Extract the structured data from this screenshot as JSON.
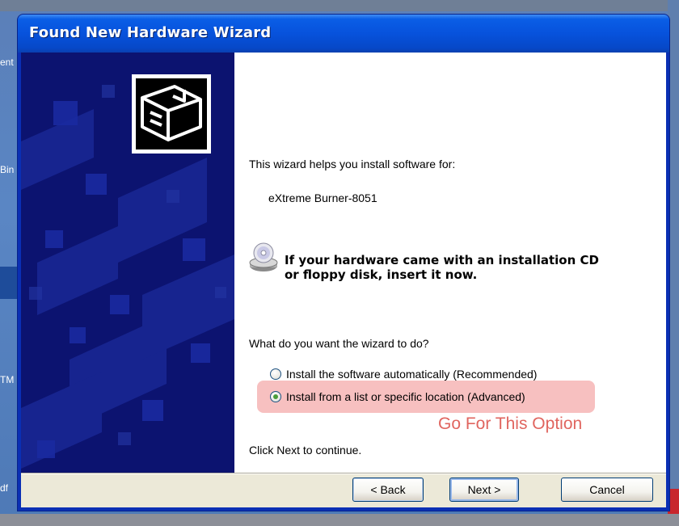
{
  "window": {
    "title": "Found New Hardware Wizard"
  },
  "wizard": {
    "intro": "This wizard helps you install software for:",
    "device_name": "eXtreme Burner-8051",
    "cd_prompt_line1": "If your hardware came with an installation CD",
    "cd_prompt_line2": "or floppy disk, insert it now.",
    "question": "What do you want the wizard to do?",
    "options": [
      {
        "label": "Install the software automatically (Recommended)",
        "selected": false
      },
      {
        "label": "Install from a list or specific location (Advanced)",
        "selected": true
      }
    ],
    "annotation": "Go For This Option",
    "continue_hint": "Click Next to continue."
  },
  "buttons": {
    "back": "< Back",
    "next": "Next >",
    "cancel": "Cancel"
  },
  "desktop": {
    "fragments": [
      "ent",
      "Bin",
      "TM",
      "df"
    ]
  },
  "colors": {
    "titlebar": "#0752dc",
    "side_panel": "#0c1370",
    "annotation": "#e0655f",
    "highlight": "#f08c8c"
  }
}
